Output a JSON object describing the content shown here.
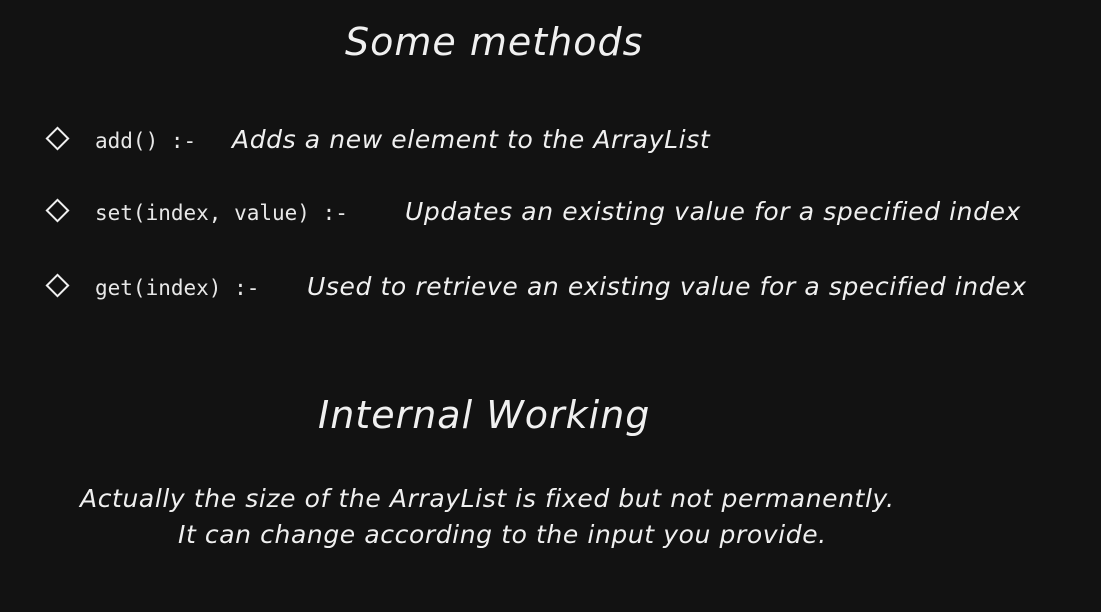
{
  "heading_methods": "Some methods",
  "methods": [
    {
      "signature": "add() :-",
      "description": "Adds a new element to the ArrayList"
    },
    {
      "signature": "set(index, value) :-",
      "description": "Updates an existing value for a specified index"
    },
    {
      "signature": "get(index) :-",
      "description": "Used to retrieve an existing value for a specified index"
    }
  ],
  "heading_internal": "Internal Working",
  "paragraph_lines": [
    "Actually the size of the ArrayList is fixed but not permanently.",
    "It can change according to the input you provide."
  ]
}
